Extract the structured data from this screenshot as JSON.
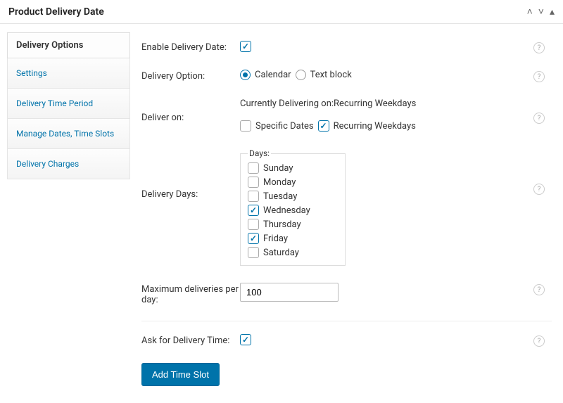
{
  "header": {
    "title": "Product Delivery Date"
  },
  "sidebar": {
    "heading": "Delivery Options",
    "items": [
      {
        "label": "Settings"
      },
      {
        "label": "Delivery Time Period"
      },
      {
        "label": "Manage Dates, Time Slots"
      },
      {
        "label": "Delivery Charges"
      }
    ]
  },
  "form": {
    "enable": {
      "label": "Enable Delivery Date:",
      "checked": true
    },
    "delivery_option": {
      "label": "Delivery Option:",
      "options": {
        "calendar": "Calendar",
        "textblock": "Text block"
      },
      "selected": "calendar"
    },
    "deliver_on": {
      "label": "Deliver on:",
      "status_prefix": "Currently Delivering on:",
      "status_value": "Recurring Weekdays",
      "specific": {
        "label": "Specific Dates",
        "checked": false
      },
      "recurring": {
        "label": "Recurring Weekdays",
        "checked": true
      }
    },
    "delivery_days": {
      "label": "Delivery Days:",
      "legend": "Days:",
      "days": [
        {
          "label": "Sunday",
          "checked": false
        },
        {
          "label": "Monday",
          "checked": false
        },
        {
          "label": "Tuesday",
          "checked": false
        },
        {
          "label": "Wednesday",
          "checked": true
        },
        {
          "label": "Thursday",
          "checked": false
        },
        {
          "label": "Friday",
          "checked": true
        },
        {
          "label": "Saturday",
          "checked": false
        }
      ]
    },
    "max_deliveries": {
      "label": "Maximum deliveries per day:",
      "value": "100"
    },
    "ask_time": {
      "label": "Ask for Delivery Time:",
      "checked": true
    },
    "add_slot": {
      "label": "Add Time Slot"
    }
  }
}
